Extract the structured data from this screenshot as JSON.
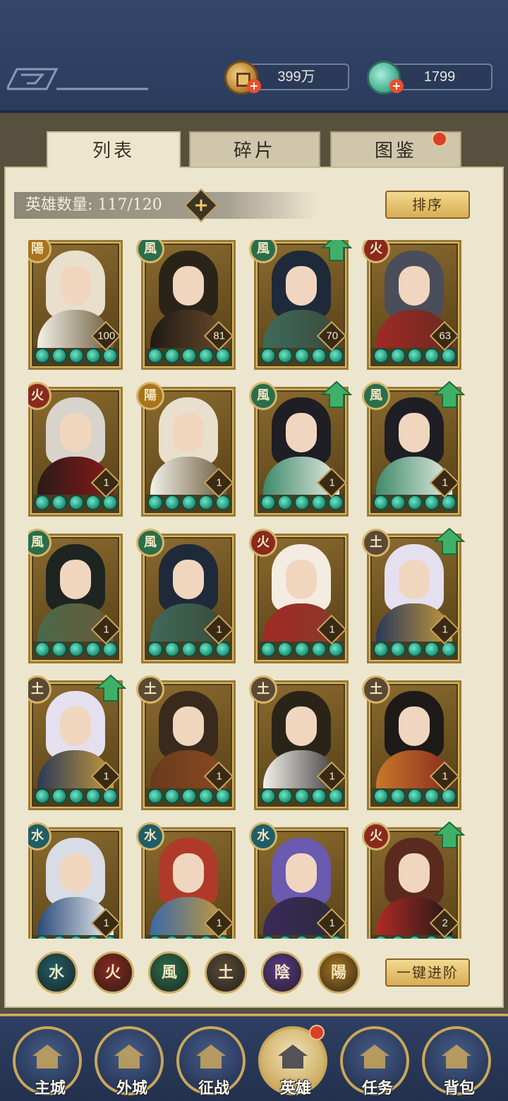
{
  "resources": {
    "coins": "399万",
    "jade": "1799",
    "plus": "+"
  },
  "tabs": [
    "列表",
    "碎片",
    "图鉴"
  ],
  "hero_count_label": "英雄数量: 117/120",
  "count_plus": "+",
  "sort_button": "排序",
  "one_click_advance_button": "一键进阶",
  "heroes": [
    {
      "element": "陽",
      "level": "100",
      "upgradable": false
    },
    {
      "element": "風",
      "level": "81",
      "upgradable": false
    },
    {
      "element": "風",
      "level": "70",
      "upgradable": true
    },
    {
      "element": "火",
      "level": "63",
      "upgradable": false
    },
    {
      "element": "火",
      "level": "1",
      "upgradable": false
    },
    {
      "element": "陽",
      "level": "1",
      "upgradable": false
    },
    {
      "element": "風",
      "level": "1",
      "upgradable": true
    },
    {
      "element": "風",
      "level": "1",
      "upgradable": true
    },
    {
      "element": "風",
      "level": "1",
      "upgradable": false
    },
    {
      "element": "風",
      "level": "1",
      "upgradable": false
    },
    {
      "element": "火",
      "level": "1",
      "upgradable": false
    },
    {
      "element": "土",
      "level": "1",
      "upgradable": true
    },
    {
      "element": "土",
      "level": "1",
      "upgradable": true
    },
    {
      "element": "土",
      "level": "1",
      "upgradable": false
    },
    {
      "element": "土",
      "level": "1",
      "upgradable": false
    },
    {
      "element": "土",
      "level": "1",
      "upgradable": false
    },
    {
      "element": "水",
      "level": "1",
      "upgradable": false
    },
    {
      "element": "水",
      "level": "1",
      "upgradable": false
    },
    {
      "element": "水",
      "level": "1",
      "upgradable": false
    },
    {
      "element": "火",
      "level": "2",
      "upgradable": true
    }
  ],
  "element_filters": [
    "水",
    "火",
    "風",
    "土",
    "陰",
    "陽"
  ],
  "element_colors": {
    "水": "#1f5e66",
    "火": "#8a2a1e",
    "風": "#2a6e4a",
    "土": "#5a4a34",
    "陰": "#5a3a86",
    "陽": "#a8741c"
  },
  "nav": [
    "主城",
    "外城",
    "征战",
    "英雄",
    "任务",
    "背包"
  ]
}
